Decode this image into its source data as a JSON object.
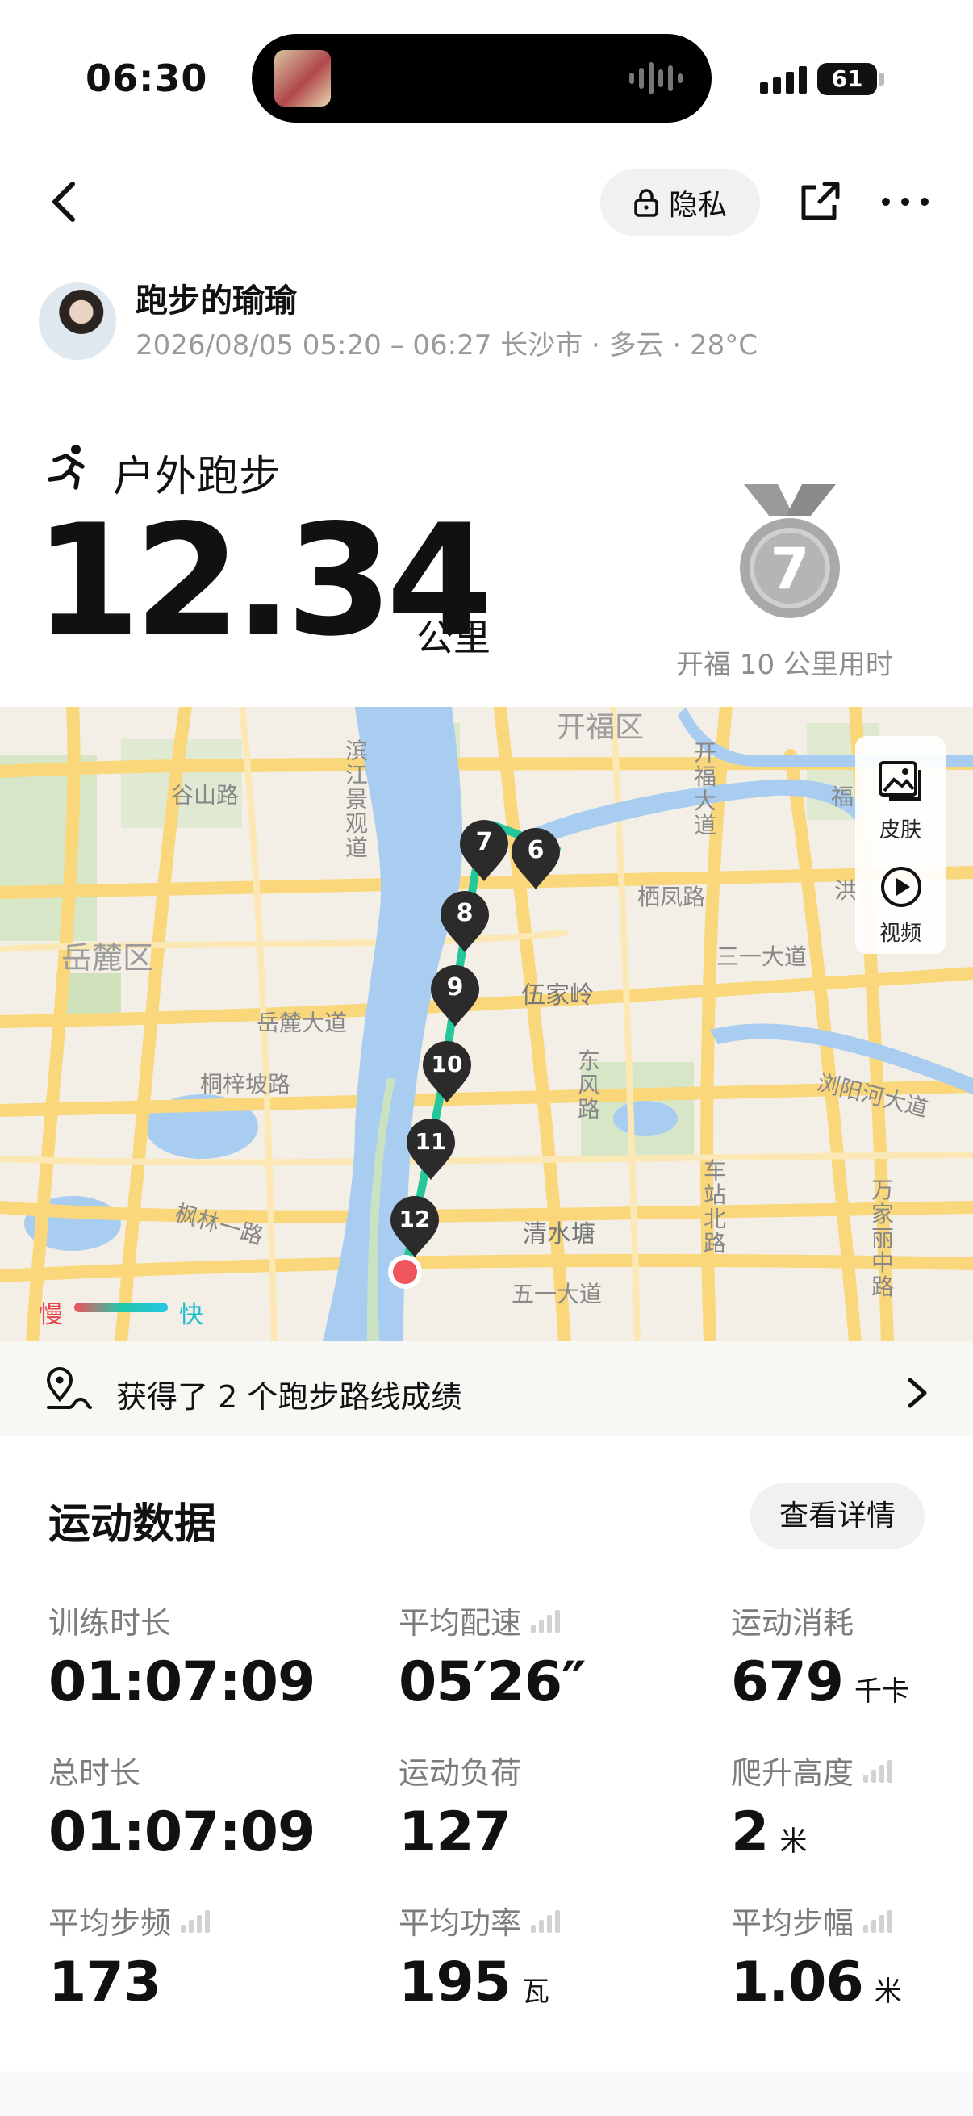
{
  "status_bar": {
    "time": "06:30",
    "battery": "61"
  },
  "header": {
    "privacy_label": "隐私"
  },
  "user": {
    "name": "跑步的瑜瑜",
    "meta": "2026/08/05 05:20 – 06:27 长沙市 · 多云 · 28°C"
  },
  "summary": {
    "sport": "户外跑步",
    "distance": "12.34",
    "unit": "公里",
    "medal_number": "7",
    "medal_caption": "开福 10 公里用时"
  },
  "map": {
    "side_skin": "皮肤",
    "side_video": "视频",
    "legend_slow": "慢",
    "legend_fast": "快",
    "km_markers": [
      "7",
      "6",
      "8",
      "9",
      "10",
      "11",
      "12"
    ],
    "labels": {
      "kaifu": "开福区",
      "gushan": "谷山路",
      "binjiang": "滨江景观道",
      "yuelu": "岳麓区",
      "qifeng": "栖凤路",
      "kaifu_ave": "开福大道",
      "fu": "福",
      "hong": "洪",
      "sanyi": "三一大道",
      "wujialing": "伍家岭",
      "yuelu_ave": "岳麓大道",
      "dongfeng": "东风路",
      "tongzi": "桐梓坡路",
      "liuyang": "浏阳河大道",
      "chezhan": "车站北路",
      "wanjiali": "万家丽中路",
      "qingshuitang": "清水塘",
      "fenglin": "枫林一路",
      "wuyi": "五一大道"
    }
  },
  "route_banner": {
    "text": "获得了 2 个跑步路线成绩"
  },
  "stats": {
    "title": "运动数据",
    "detail_button": "查看详情",
    "items": [
      {
        "label": "训练时长",
        "value": "01:07:09",
        "unit": ""
      },
      {
        "label": "平均配速",
        "value": "05′26″",
        "unit": ""
      },
      {
        "label": "运动消耗",
        "value": "679",
        "unit": "千卡"
      },
      {
        "label": "总时长",
        "value": "01:07:09",
        "unit": ""
      },
      {
        "label": "运动负荷",
        "value": "127",
        "unit": ""
      },
      {
        "label": "爬升高度",
        "value": "2",
        "unit": "米"
      },
      {
        "label": "平均步频",
        "value": "173",
        "unit": ""
      },
      {
        "label": "平均功率",
        "value": "195",
        "unit": "瓦"
      },
      {
        "label": "平均步幅",
        "value": "1.06",
        "unit": "米"
      }
    ]
  },
  "colors": {
    "accent_route": "#24c79a",
    "start_marker": "#f0545c",
    "river": "#a9cdf0",
    "road": "#f9d77a"
  }
}
